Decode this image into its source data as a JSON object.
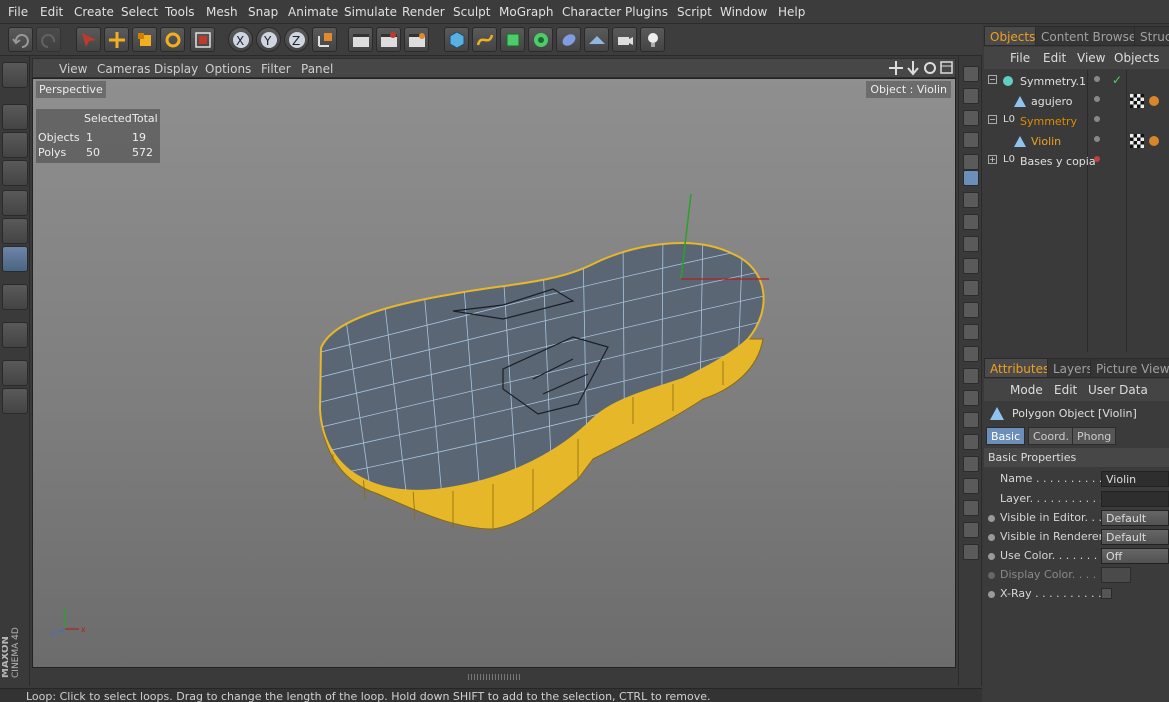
{
  "menu": [
    "File",
    "Edit",
    "Create",
    "Select",
    "Tools",
    "Mesh",
    "Snap",
    "Animate",
    "Simulate",
    "Render",
    "Sculpt",
    "MoGraph",
    "Character",
    "Plugins",
    "Script",
    "Window",
    "Help"
  ],
  "viewport": {
    "menu": [
      "View",
      "Cameras",
      "Display",
      "Options",
      "Filter",
      "Panel"
    ],
    "camera_label": "Perspective",
    "object_label": "Object : Violin",
    "hud": {
      "header_selected": "Selected",
      "header_total": "Total",
      "rows": [
        {
          "label": "Objects",
          "selected": "1",
          "total": "19"
        },
        {
          "label": "Polys",
          "selected": "50",
          "total": "572"
        }
      ]
    }
  },
  "objects_panel": {
    "tabs": [
      "Objects",
      "Content Browser",
      "Struct"
    ],
    "menu": [
      "File",
      "Edit",
      "View",
      "Objects"
    ],
    "items": [
      {
        "name": "Symmetry.1",
        "color": "#e0e0e0"
      },
      {
        "name": "agujero",
        "color": "#e0e0e0"
      },
      {
        "name": "Symmetry",
        "color": "#e08a00"
      },
      {
        "name": "Violin",
        "color": "#f0a020"
      },
      {
        "name": "Bases y copia",
        "color": "#e0e0e0"
      }
    ]
  },
  "attributes_panel": {
    "tabs": [
      "Attributes",
      "Layers",
      "Picture Viewer"
    ],
    "menu": [
      "Mode",
      "Edit",
      "User Data"
    ],
    "object_title": "Polygon Object [Violin]",
    "subtabs": [
      "Basic",
      "Coord.",
      "Phong"
    ],
    "section": "Basic Properties",
    "props": [
      {
        "label": "Name . . . . . . . . . . .",
        "value": "Violin"
      },
      {
        "label": "Layer. . . . . . . . . . . .",
        "value": ""
      },
      {
        "label": "Visible in Editor. . .",
        "value": "Default"
      },
      {
        "label": "Visible in Renderer",
        "value": "Default"
      },
      {
        "label": "Use Color. . . . . . . .",
        "value": "Off"
      },
      {
        "label": "Display Color. . . .",
        "value": ""
      },
      {
        "label": "X-Ray . . . . . . . . . .",
        "value": ""
      }
    ]
  },
  "status": "Loop: Click to select loops. Drag to change the length of the loop. Hold down SHIFT to add to the selection, CTRL to remove.",
  "brand": {
    "line1": "MAXON",
    "line2": "CINEMA 4D"
  },
  "axis_labels": {
    "x": "x",
    "y": "Y",
    "z": "z"
  },
  "colors": {
    "accent": "#f0a020",
    "selection_blue": "#6b8fb8",
    "mesh_body": "#5a6673",
    "mesh_side": "#e7b72a"
  }
}
